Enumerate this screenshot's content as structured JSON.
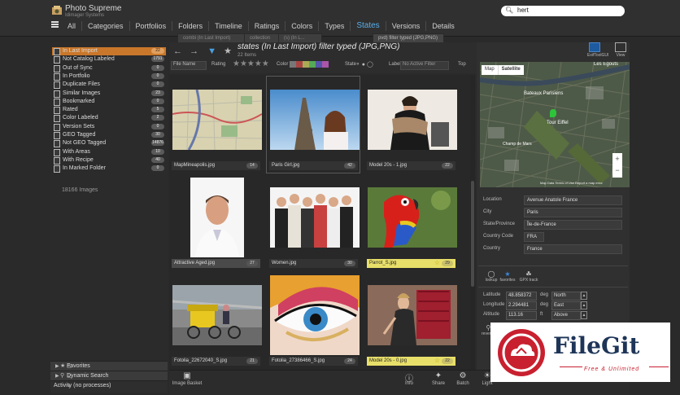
{
  "app": {
    "title": "Photo Supreme",
    "subtitle": "Idimager Systems"
  },
  "search": {
    "value": "hert"
  },
  "nav": {
    "items": [
      "All",
      "Categories",
      "Portfolios",
      "Folders",
      "Timeline",
      "Ratings",
      "Colors",
      "Types",
      "States",
      "Versions",
      "Details"
    ],
    "active": "States"
  },
  "tabs": [
    "combi (In Last Import)",
    "collection",
    "(s) (In L...",
    "pvd) filter typed (JPG,PNG)"
  ],
  "states": [
    {
      "label": "In Last Import",
      "count": "22",
      "selected": true
    },
    {
      "label": "Not Catalog Labeled",
      "count": "1791"
    },
    {
      "label": "Out of Sync",
      "count": "0"
    },
    {
      "label": "In Portfolio",
      "count": "0"
    },
    {
      "label": "Duplicate Files",
      "count": "0"
    },
    {
      "label": "Similar Images",
      "count": "23"
    },
    {
      "label": "Bookmarked",
      "count": "0"
    },
    {
      "label": "Rated",
      "count": "5"
    },
    {
      "label": "Color Labeled",
      "count": "2"
    },
    {
      "label": "Version Sets",
      "count": "0"
    },
    {
      "label": "GEO Tagged",
      "count": "30"
    },
    {
      "label": "Not GEO Tagged",
      "count": "14876"
    },
    {
      "label": "With Areas",
      "count": "10"
    },
    {
      "label": "With Recipe",
      "count": "40"
    },
    {
      "label": "In Marked Folder",
      "count": "0"
    }
  ],
  "images_total": "18166 Images",
  "left_bottom": {
    "favorites": "Favorites",
    "dynamic_search": "Dynamic Search",
    "activity": "Activity (no processes)"
  },
  "grid": {
    "title": "states (In Last Import) filter typed (JPG,PNG)",
    "count": "22 Items",
    "filter_rating_label": "Rating",
    "filter_color_label": "Color",
    "filter_state_label": "State",
    "filter_label_label": "Label",
    "filter_label_value": "No Active Filter",
    "filter_top_label": "Top",
    "sort_label": "File Name"
  },
  "thumbnails": [
    {
      "name": "MapMineapolis.jpg",
      "badge": "14",
      "style": "normal",
      "starred": false
    },
    {
      "name": "Paris Girl.jpg",
      "badge": "42",
      "style": "normal",
      "starred": false,
      "selected": true
    },
    {
      "name": "Model 20s - 1.jpg",
      "badge": "22",
      "style": "normal",
      "starred": false
    },
    {
      "name": "Attractive Aged.jpg",
      "badge": "27",
      "style": "grey",
      "starred": false
    },
    {
      "name": "Women.jpg",
      "badge": "30",
      "style": "normal",
      "starred": false
    },
    {
      "name": "Parrot_S.jpg",
      "badge": "29",
      "style": "yellow",
      "starred": true
    },
    {
      "name": "Fotolia_22672040_S.jpg",
      "badge": "21",
      "style": "normal",
      "starred": false
    },
    {
      "name": "Fotolia_27386466_S.jpg",
      "badge": "24",
      "style": "normal",
      "starred": false
    },
    {
      "name": "Model 20s - 0.jpg",
      "badge": "22",
      "style": "yellow",
      "starred": true
    }
  ],
  "right": {
    "exif_label": "ExifToolGUI",
    "view_label": "View",
    "map_buttons": [
      "Map",
      "Satellite"
    ],
    "map_active": "Satellite",
    "map_places": [
      "Bateaux Parisiens",
      "Tour Eiffel",
      "Les Égouts",
      "Champ de Mars"
    ],
    "map_footer": "Map Data   Terms of Use   Report a map error",
    "fields": [
      {
        "label": "Location",
        "value": "Avenue Anatole France"
      },
      {
        "label": "City",
        "value": "Paris"
      },
      {
        "label": "State/Province",
        "value": "Île-de-France"
      },
      {
        "label": "Country Code",
        "value": "FRA"
      },
      {
        "label": "Country",
        "value": "France"
      }
    ],
    "lookups": [
      "lookup",
      "favorites",
      "GPX track"
    ],
    "latitude": {
      "label": "Latitude",
      "value": "48.858372",
      "unit": "deg",
      "dir": "North"
    },
    "longitude": {
      "label": "Longitude",
      "value": "2.294481",
      "unit": "deg",
      "dir": "East"
    },
    "altitude": {
      "label": "Altitude",
      "value": "113.16",
      "unit": "ft",
      "dir": "Above"
    },
    "reverse_label": "reverse"
  },
  "bottom": {
    "basket": "Image Basket",
    "buttons": [
      "Info",
      "Share",
      "Batch",
      "Light"
    ]
  },
  "watermark": {
    "title": "FileGit",
    "subtitle": "Free & Unlimited"
  },
  "colors": {
    "accent": "#5aaee8",
    "selected": "#c9772a",
    "yellow": "#e8df6a",
    "brand_red": "#c8202f",
    "brand_blue": "#1e3558"
  }
}
